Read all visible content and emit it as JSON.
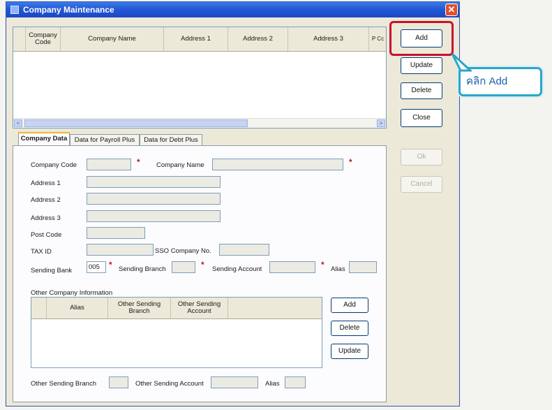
{
  "window": {
    "title": "Company Maintenance",
    "close_glyph": "✕"
  },
  "grid": {
    "columns": [
      "Company Code",
      "Company Name",
      "Address 1",
      "Address 2",
      "Address 3",
      "P Cc"
    ],
    "scroll_left": "<",
    "scroll_right": ">"
  },
  "buttons": {
    "add": "Add",
    "update": "Update",
    "delete": "Delete",
    "close": "Close",
    "ok": "Ok",
    "cancel": "Cancel"
  },
  "tabs": [
    "Company Data",
    "Data for Payroll Plus",
    "Data for Debt Plus"
  ],
  "form": {
    "company_code_label": "Company Code",
    "company_name_label": "Company Name",
    "address1_label": "Address 1",
    "address2_label": "Address 2",
    "address3_label": "Address 3",
    "post_code_label": "Post Code",
    "tax_id_label": "TAX ID",
    "sso_label": "SSO Company No.",
    "sending_bank_label": "Sending Bank",
    "sending_bank_value": "005",
    "sending_branch_label": "Sending Branch",
    "sending_account_label": "Sending Account",
    "alias_label": "Alias",
    "required_mark": "*"
  },
  "other": {
    "section_label": "Other Company Information",
    "columns": [
      "Alias",
      "Other Sending Branch",
      "Other Sending Account"
    ],
    "add": "Add",
    "delete": "Delete",
    "update": "Update",
    "other_branch_label": "Other Sending Branch",
    "other_account_label": "Other Sending Account",
    "alias_label": "Alias"
  },
  "callout": {
    "text": "คลิก Add"
  },
  "colors": {
    "title_bar": "#2358d6",
    "highlight": "#c8102e",
    "callout_border": "#2aa6c8"
  }
}
